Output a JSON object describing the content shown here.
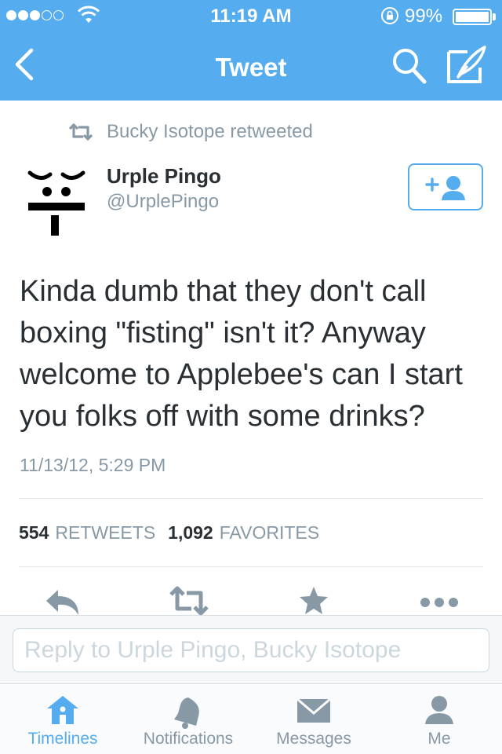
{
  "status_bar": {
    "signal_bars": 3,
    "signal_total": 5,
    "time": "11:19 AM",
    "battery_percent": "99%",
    "battery_level": 0.99
  },
  "nav": {
    "title": "Tweet",
    "icons": [
      "chevron-left-icon",
      "search-icon",
      "compose-icon"
    ]
  },
  "tweet": {
    "retweeted_by": "Bucky Isotope retweeted",
    "author_name": "Urple Pingo",
    "author_handle": "@UrplePingo",
    "text": "Kinda dumb that they don't call boxing \"fisting\" isn't it? Anyway welcome to Applebee's can I start you folks off with some drinks?",
    "timestamp": "11/13/12, 5:29 PM",
    "retweets_count": "554",
    "retweets_label": "RETWEETS",
    "favorites_count": "1,092",
    "favorites_label": "FAVORITES"
  },
  "actions": [
    "reply-icon",
    "retweet-icon",
    "star-icon",
    "more-icon"
  ],
  "reply": {
    "placeholder": "Reply to Urple Pingo, Bucky Isotope"
  },
  "tabs": [
    {
      "label": "Timelines",
      "icon": "home-icon",
      "active": true
    },
    {
      "label": "Notifications",
      "icon": "bell-icon",
      "active": false
    },
    {
      "label": "Messages",
      "icon": "envelope-icon",
      "active": false
    },
    {
      "label": "Me",
      "icon": "person-icon",
      "active": false
    }
  ],
  "colors": {
    "brand": "#55acee",
    "text": "#292f33",
    "muted": "#8899a6",
    "border": "#e1e8ed"
  }
}
